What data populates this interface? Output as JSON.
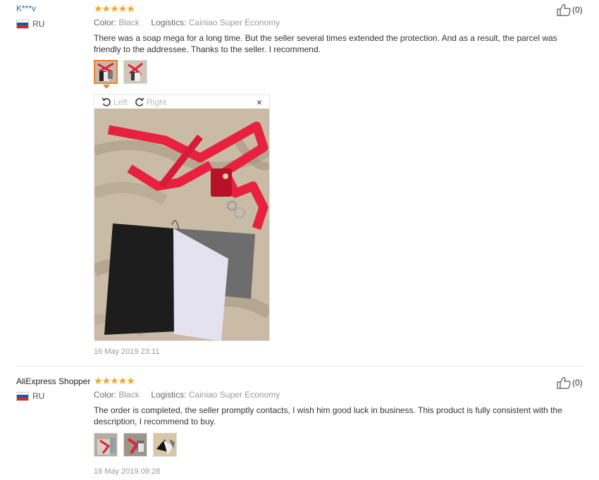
{
  "reviews": [
    {
      "user": "K***v",
      "country": "RU",
      "stars": "★★★★★",
      "rating": 5,
      "color_label": "Color:",
      "color_value": "Black",
      "logistics_label": "Logistics:",
      "logistics_value": "Cainiao Super Economy",
      "text": "There was a soap mega for a long time. But the seller several times extended the protection. And as a result, the parcel was friendly to the addressee. Thanks to the seller. I recommend.",
      "helpful_count": "(0)",
      "date": "16 May 2019 23:11",
      "viewer": {
        "left_label": "Left",
        "right_label": "Right",
        "close": "×"
      }
    },
    {
      "user": "AliExpress Shopper",
      "country": "RU",
      "stars": "★★★★★",
      "rating": 5,
      "color_label": "Color:",
      "color_value": "Black",
      "logistics_label": "Logistics:",
      "logistics_value": "Cainiao Super Economy",
      "text": "The order is completed, the seller promptly contacts, I wish him good luck in business. This product is fully consistent with the description, I recommend to buy.",
      "helpful_count": "(0)",
      "date": "18 May 2019 09:28"
    }
  ],
  "colors": {
    "star": "#f5a623",
    "username_link": "#1a6fb3",
    "thumb_active": "#e8812e",
    "muted": "#999999"
  },
  "icons": [
    "thumbs-up-icon",
    "rotate-left-icon",
    "rotate-right-icon",
    "close-icon",
    "ru-flag-icon",
    "star-icon"
  ]
}
